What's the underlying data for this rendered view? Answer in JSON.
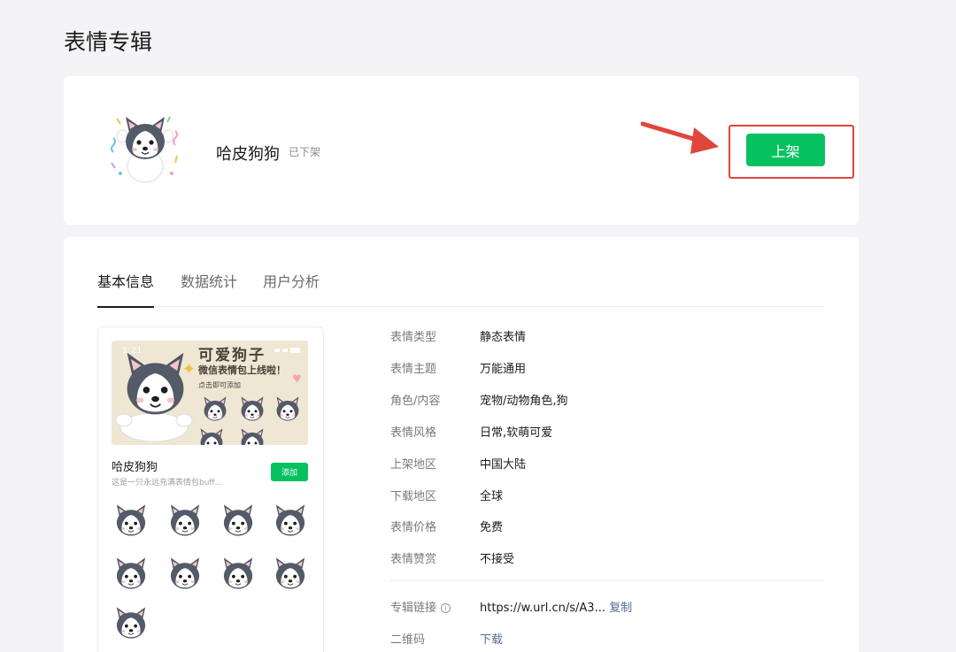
{
  "page": {
    "title": "表情专辑"
  },
  "album": {
    "name": "哈皮狗狗",
    "status": "已下架",
    "publish_label": "上架"
  },
  "colors": {
    "accent": "#07c160",
    "annotation": "#e0463c",
    "link": "#576b95"
  },
  "tabs": [
    {
      "label": "基本信息",
      "active": true
    },
    {
      "label": "数据统计",
      "active": false
    },
    {
      "label": "用户分析",
      "active": false
    }
  ],
  "preview": {
    "banner": {
      "time": "1:21",
      "title": "可爱狗子",
      "subtitle": "微信表情包上线啦！",
      "hint": "点击即可添加"
    },
    "name": "哈皮狗狗",
    "description": "这是一只永远充满表情包buff...",
    "add_label": "添加"
  },
  "info": {
    "rows": [
      {
        "label": "表情类型",
        "value": "静态表情"
      },
      {
        "label": "表情主题",
        "value": "万能通用"
      },
      {
        "label": "角色/内容",
        "value": "宠物/动物角色,狗"
      },
      {
        "label": "表情风格",
        "value": "日常,软萌可爱"
      },
      {
        "label": "上架地区",
        "value": "中国大陆"
      },
      {
        "label": "下载地区",
        "value": "全球"
      },
      {
        "label": "表情价格",
        "value": "免费"
      },
      {
        "label": "表情赞赏",
        "value": "不接受"
      }
    ],
    "link_label": "专辑链接",
    "link_tip": "i",
    "link_value": "https://w.url.cn/s/A3...",
    "copy_label": "复制",
    "qr_label": "二维码",
    "download_label": "下载"
  }
}
